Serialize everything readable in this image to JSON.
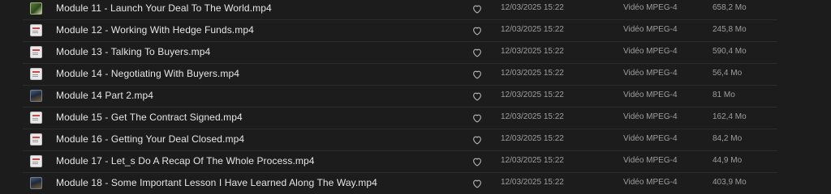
{
  "rows": [
    {
      "name": "Module 11 - Launch Your Deal To The World.mp4",
      "date": "12/03/2025 15:22",
      "kind": "Vidéo MPEG-4",
      "size": "658,2 Mo",
      "thumb": "green"
    },
    {
      "name": "Module 12 - Working With Hedge Funds.mp4",
      "date": "12/03/2025 15:22",
      "kind": "Vidéo MPEG-4",
      "size": "245,8 Mo",
      "thumb": "light"
    },
    {
      "name": "Module 13 - Talking To Buyers.mp4",
      "date": "12/03/2025 15:22",
      "kind": "Vidéo MPEG-4",
      "size": "590,4 Mo",
      "thumb": "light"
    },
    {
      "name": "Module 14 - Negotiating With Buyers.mp4",
      "date": "12/03/2025 15:22",
      "kind": "Vidéo MPEG-4",
      "size": "56,4 Mo",
      "thumb": "light"
    },
    {
      "name": "Module 14 Part 2.mp4",
      "date": "12/03/2025 15:22",
      "kind": "Vidéo MPEG-4",
      "size": "81 Mo",
      "thumb": "dark"
    },
    {
      "name": "Module 15 - Get The Contract Signed.mp4",
      "date": "12/03/2025 15:22",
      "kind": "Vidéo MPEG-4",
      "size": "162,4 Mo",
      "thumb": "light"
    },
    {
      "name": "Module 16 - Getting Your Deal Closed.mp4",
      "date": "12/03/2025 15:22",
      "kind": "Vidéo MPEG-4",
      "size": "84,2 Mo",
      "thumb": "light"
    },
    {
      "name": "Module 17 - Let_s Do A Recap Of The Whole Process.mp4",
      "date": "12/03/2025 15:22",
      "kind": "Vidéo MPEG-4",
      "size": "44,9 Mo",
      "thumb": "light"
    },
    {
      "name": "Module 18 - Some Important Lesson I Have Learned Along The Way.mp4",
      "date": "12/03/2025 15:22",
      "kind": "Vidéo MPEG-4",
      "size": "403,9 Mo",
      "thumb": "dark"
    }
  ],
  "icons": {
    "favorite": "heart-outline-icon"
  },
  "colors": {
    "background": "#1c1c1c",
    "text": "#e6e6e6",
    "muted": "#9e9e9e",
    "divider": "#2c2c2c"
  }
}
